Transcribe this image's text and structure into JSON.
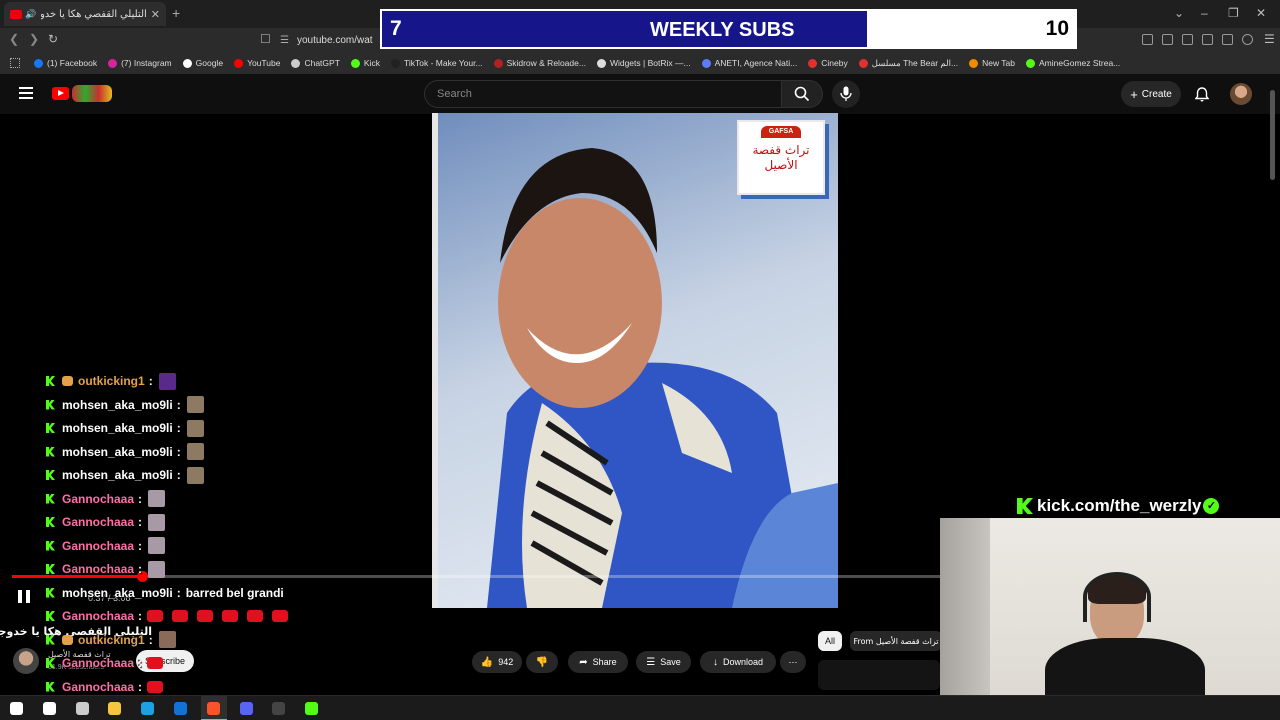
{
  "browser": {
    "tab_title": "التليلي القفصي هكا يا خدوجة",
    "url": "youtube.com/wat",
    "bookmarks": [
      {
        "label": "(1) Facebook",
        "color": "#1877f2"
      },
      {
        "label": "(7) Instagram",
        "color": "#d6249f"
      },
      {
        "label": "Google",
        "color": "#ffffff"
      },
      {
        "label": "YouTube",
        "color": "#ff0000"
      },
      {
        "label": "ChatGPT",
        "color": "#cccccc"
      },
      {
        "label": "Kick",
        "color": "#53fc18"
      },
      {
        "label": "TikTok - Make Your...",
        "color": "#222222"
      },
      {
        "label": "Skidrow & Reloade...",
        "color": "#b22222"
      },
      {
        "label": "Widgets | BotRix —...",
        "color": "#dddddd"
      },
      {
        "label": "ANETI, Agence Nati...",
        "color": "#5c7cfa"
      },
      {
        "label": "Cineby",
        "color": "#e03131"
      },
      {
        "label": "مسلسل The Bear الم...",
        "color": "#e03131"
      },
      {
        "label": "New Tab",
        "color": "#f08c00"
      },
      {
        "label": "AmineGomez Strea...",
        "color": "#53fc18"
      }
    ]
  },
  "overlay": {
    "subs_current": "7",
    "subs_label": "WEEKLY SUBS",
    "subs_goal": "10",
    "subs_progress": 0.7,
    "kick_handle": "kick.com/the_werzly"
  },
  "youtube": {
    "search_placeholder": "Search",
    "create_label": "Create",
    "stamp_brand": "GAFSA",
    "stamp_text": "تراث قفصة الأصيل",
    "progress": 0.14,
    "time_label": "0:37 / 3:08",
    "video_title": "التليلي القفصي هكا يا خدوجة",
    "channel_name": "تراث قفصة الأصيل",
    "channel_subs": "31.9K subscribers",
    "subscribe_label": "Subscribe",
    "likes": "942",
    "share_label": "Share",
    "save_label": "Save",
    "download_label": "Download",
    "chip_all": "All",
    "chip_from": "From تراث قفصة الأصيل"
  },
  "chat": [
    {
      "user": "outkicking1",
      "color": "#e2a14b",
      "sub": true,
      "msg": "",
      "emotes": [
        "#5a2a8a"
      ]
    },
    {
      "user": "mohsen_aka_mo9li",
      "color": "#ffffff",
      "sub": false,
      "msg": "",
      "emotes": [
        "#8c7a62"
      ]
    },
    {
      "user": "mohsen_aka_mo9li",
      "color": "#ffffff",
      "sub": false,
      "msg": "",
      "emotes": [
        "#8c7a62"
      ]
    },
    {
      "user": "mohsen_aka_mo9li",
      "color": "#ffffff",
      "sub": false,
      "msg": "",
      "emotes": [
        "#8c7a62"
      ]
    },
    {
      "user": "mohsen_aka_mo9li",
      "color": "#ffffff",
      "sub": false,
      "msg": "",
      "emotes": [
        "#8c7a62"
      ]
    },
    {
      "user": "Gannochaaa",
      "color": "#ff6fa8",
      "sub": false,
      "msg": "",
      "emotes": [
        "#a79aa6"
      ]
    },
    {
      "user": "Gannochaaa",
      "color": "#ff6fa8",
      "sub": false,
      "msg": "",
      "emotes": [
        "#a79aa6"
      ]
    },
    {
      "user": "Gannochaaa",
      "color": "#ff6fa8",
      "sub": false,
      "msg": "",
      "emotes": [
        "#a79aa6"
      ]
    },
    {
      "user": "Gannochaaa",
      "color": "#ff6fa8",
      "sub": false,
      "msg": "",
      "emotes": [
        "#a79aa6"
      ]
    },
    {
      "user": "mohsen_aka_mo9li",
      "color": "#ffffff",
      "sub": false,
      "msg": "barred bel grandi",
      "emotes": []
    },
    {
      "user": "Gannochaaa",
      "color": "#ff6fa8",
      "sub": false,
      "msg": "",
      "red": 6
    },
    {
      "user": "outkicking1",
      "color": "#e2a14b",
      "sub": true,
      "msg": "",
      "emotes": [
        "#8a6b5a"
      ]
    },
    {
      "user": "Gannochaaa",
      "color": "#ff6fa8",
      "sub": false,
      "msg": "",
      "red": 1
    },
    {
      "user": "Gannochaaa",
      "color": "#ff6fa8",
      "sub": false,
      "msg": "",
      "red": 1
    }
  ],
  "taskbar": [
    {
      "name": "windows-start-icon",
      "color": "#ffffff"
    },
    {
      "name": "search-icon",
      "color": "#ffffff"
    },
    {
      "name": "task-view-icon",
      "color": "#cccccc"
    },
    {
      "name": "file-explorer-icon",
      "color": "#f5c542"
    },
    {
      "name": "edge-icon",
      "color": "#1ea0e6"
    },
    {
      "name": "outlook-icon",
      "color": "#1273d6"
    },
    {
      "name": "brave-icon",
      "color": "#fb542b",
      "active": true
    },
    {
      "name": "discord-icon",
      "color": "#5865f2"
    },
    {
      "name": "obs-icon",
      "color": "#444444"
    },
    {
      "name": "app-icon",
      "color": "#53fc18"
    }
  ]
}
